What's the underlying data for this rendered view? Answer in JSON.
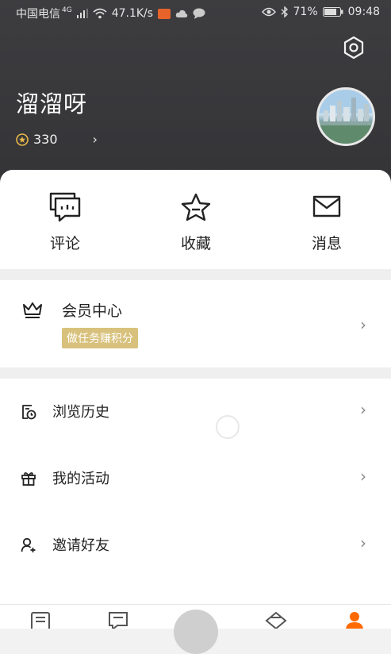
{
  "status_bar": {
    "carrier": "中国电信",
    "network": "4G",
    "speed": "47.1K/s",
    "battery": "71%",
    "time": "09:48"
  },
  "profile": {
    "username": "溜溜呀",
    "points": "330",
    "settings_icon": "hexagon-gear-icon"
  },
  "quick_actions": [
    {
      "label": "评论",
      "icon": "comment-icon"
    },
    {
      "label": "收藏",
      "icon": "star-icon"
    },
    {
      "label": "消息",
      "icon": "mail-icon"
    }
  ],
  "member": {
    "title": "会员中心",
    "badge": "做任务赚积分",
    "icon": "crown-icon"
  },
  "menu": [
    {
      "label": "浏览历史",
      "icon": "history-icon"
    },
    {
      "label": "我的活动",
      "icon": "gift-icon"
    },
    {
      "label": "邀请好友",
      "icon": "add-user-icon"
    }
  ],
  "colors": {
    "header_bg": "#3a3a3d",
    "badge_bg": "#d8c17c",
    "accent": "#ff6a00"
  }
}
